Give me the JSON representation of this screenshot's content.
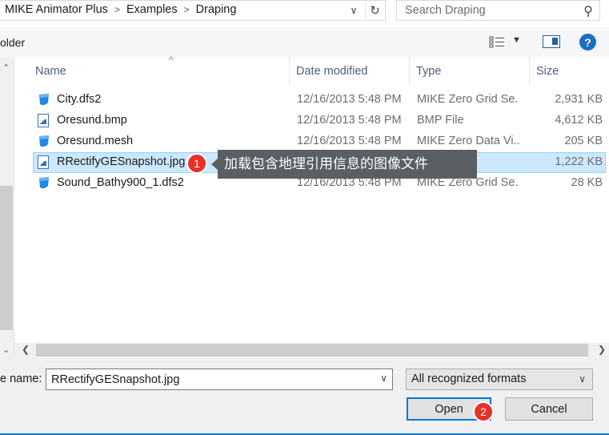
{
  "address": {
    "breadcrumbs": [
      "MIKE Animator Plus",
      "Examples",
      "Draping"
    ],
    "separator": ">",
    "dropdown_icon": "chevron-down-icon",
    "refresh_icon": "refresh-icon"
  },
  "search": {
    "placeholder": "Search Draping",
    "icon": "search-icon"
  },
  "toolbar": {
    "folder_label": "older",
    "view_icon": "details-view-icon",
    "pane_icon": "preview-pane-icon",
    "help_label": "?"
  },
  "columns": {
    "name": "Name",
    "date": "Date modified",
    "type": "Type",
    "size": "Size",
    "sort_indicator": "^"
  },
  "files": [
    {
      "name": "City.dfs2",
      "date": "12/16/2013 5:48 PM",
      "type": "MIKE Zero Grid Se...",
      "size": "2,931 KB",
      "icon": "mike-file-icon"
    },
    {
      "name": "Oresund.bmp",
      "date": "12/16/2013 5:48 PM",
      "type": "BMP File",
      "size": "4,612 KB",
      "icon": "image-file-icon"
    },
    {
      "name": "Oresund.mesh",
      "date": "12/16/2013 5:48 PM",
      "type": "MIKE Zero Data Vi...",
      "size": "205 KB",
      "icon": "mike-file-icon"
    },
    {
      "name": "RRectifyGESnapshot.jpg",
      "date": "",
      "type": "",
      "size": "1,222 KB",
      "icon": "image-file-icon",
      "selected": true
    },
    {
      "name": "Sound_Bathy900_1.dfs2",
      "date": "12/16/2013 5:48 PM",
      "type": "MIKE Zero Grid Se...",
      "size": "28 KB",
      "icon": "mike-file-icon"
    }
  ],
  "annotations": {
    "badge1": "1",
    "callout": "加载包含地理引用信息的图像文件",
    "badge2": "2"
  },
  "bottom": {
    "file_name_label": "e name:",
    "file_name_value": "RRectifyGESnapshot.jpg",
    "file_type": "All recognized formats",
    "open_label": "Open",
    "cancel_label": "Cancel"
  },
  "colors": {
    "accent": "#0078d7",
    "selection": "#cce8ff",
    "badge": "#e8302b",
    "callout": "#5a5f63",
    "mike_icon": "#1e88e5"
  }
}
